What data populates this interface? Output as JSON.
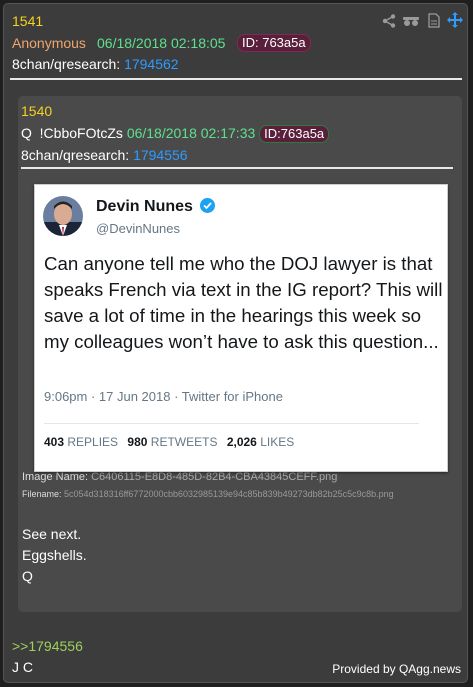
{
  "post": {
    "number": "1541",
    "author": "Anonymous",
    "datetime": "06/18/2018 02:18:05",
    "id_label": "ID: 763a5a",
    "board": "8chan/qresearch:",
    "thread": "1794562",
    "reply_ref": ">>1794556",
    "reply_text": "J C"
  },
  "quoted": {
    "number": "1540",
    "name": "Q",
    "tripcode": "!CbboFOtcZs",
    "datetime": "06/18/2018 02:17:33",
    "id_label": "ID:763a5a",
    "board": "8chan/qresearch:",
    "thread": "1794556",
    "image_name_label": "Image Name:",
    "image_name": "C6406115-E8D8-485D-82B4-CBA43845CEFF.png",
    "filename_label": "Filename:",
    "filename": "5c054d318316ff6772000cbb6032985139e94c85b839b49273db82b25c5c9c8b.png",
    "body_lines": [
      "See next.",
      "Eggshells.",
      "Q"
    ]
  },
  "tweet": {
    "display_name": "Devin Nunes",
    "handle": "@DevinNunes",
    "text": "Can anyone tell me who the DOJ lawyer is that speaks French via text in the IG report?  This will save a lot of time in the hearings this week so my colleagues won’t have to ask this question...",
    "meta": "9:06pm · 17 Jun 2018 · Twitter for iPhone",
    "replies_count": "403",
    "replies_label": "REPLIES",
    "retweets_count": "980",
    "retweets_label": "RETWEETS",
    "likes_count": "2,026",
    "likes_label": "LIKES"
  },
  "footer": {
    "provided_by": "Provided by QAgg.news"
  },
  "toolbar_icons": [
    "share-icon",
    "incognito-icon",
    "document-icon",
    "bell-icon",
    "move-icon"
  ]
}
